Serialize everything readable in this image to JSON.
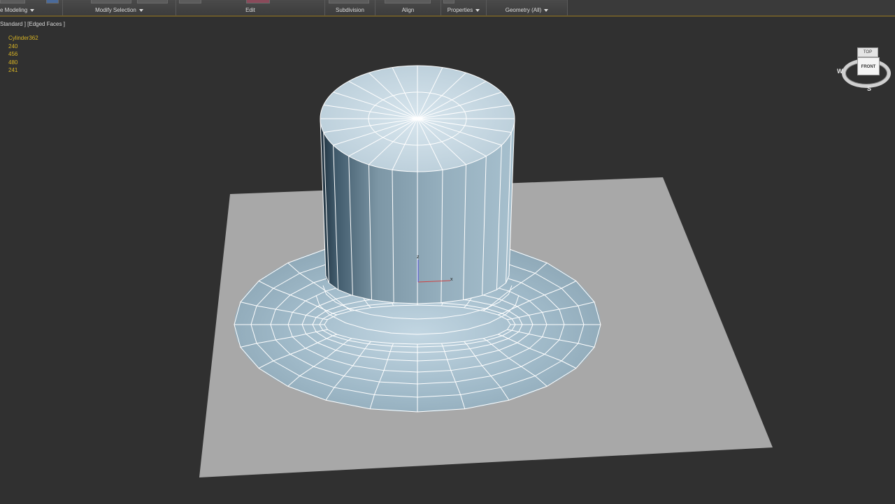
{
  "ribbon": {
    "groups": [
      {
        "label": "Modeling",
        "prefix": "e ",
        "dropdown": true
      },
      {
        "label": "Modify Selection",
        "dropdown": true
      },
      {
        "label": "Edit",
        "dropdown": false
      },
      {
        "label": "Subdivision",
        "dropdown": false
      },
      {
        "label": "Align",
        "dropdown": false
      },
      {
        "label": "Properties",
        "dropdown": true
      },
      {
        "label": "Geometry (All)",
        "dropdown": true
      }
    ]
  },
  "viewport": {
    "label": "Standard ] [Edged Faces ]",
    "stats": {
      "object_name": "Cylinder362",
      "line_1": "240",
      "line_2": "456",
      "line_3": "480",
      "line_4": "241"
    },
    "gizmo": {
      "x_label": "x",
      "z_label": "z"
    },
    "viewcube": {
      "top_label": "TOP",
      "front_label": "FRONT",
      "west_label": "W",
      "south_label": "S"
    }
  },
  "colors": {
    "viewport_bg": "#303030",
    "ground_plane": "#a8a8a8",
    "mesh_fill": "#8fa9b8",
    "mesh_wire": "#ffffff",
    "stats_text": "#d7b324",
    "accent_line": "#6b5a2a"
  }
}
